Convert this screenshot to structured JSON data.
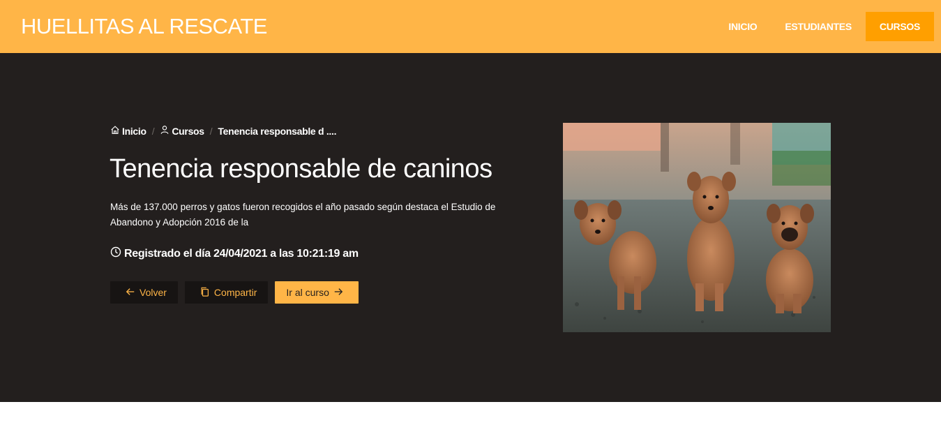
{
  "header": {
    "brand": "HUELLITAS AL RESCATE",
    "nav": [
      {
        "label": "INICIO"
      },
      {
        "label": "ESTUDIANTES"
      },
      {
        "label": "CURSOS"
      }
    ],
    "accent_color": "#ffb547",
    "active_color": "#ff9f00"
  },
  "breadcrumb": {
    "items": [
      {
        "label": "Inicio",
        "icon": "home-icon"
      },
      {
        "label": "Cursos",
        "icon": "user-icon"
      },
      {
        "label": "Tenencia responsable d ...."
      }
    ]
  },
  "course": {
    "title": "Tenencia responsable de caninos",
    "description": "Más de 137.000 perros y gatos fueron recogidos el año pasado según destaca el Estudio de Abandono y Adopción 2016 de la",
    "registered": "Registrado el día 24/04/2021 a las 10:21:19 am"
  },
  "actions": {
    "back_label": "Volver",
    "share_label": "Compartir",
    "go_label": "Ir al curso"
  },
  "hero_background": "#231f1e"
}
